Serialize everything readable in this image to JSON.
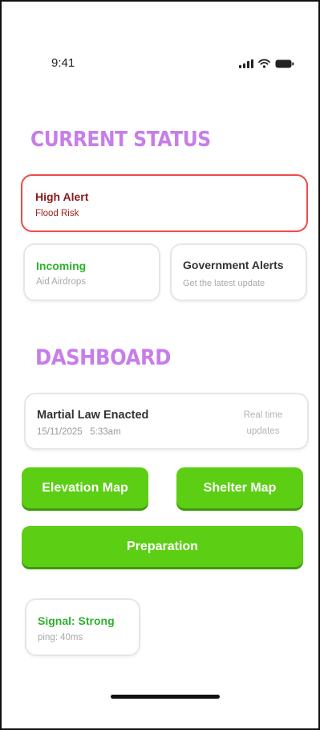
{
  "status_bar": {
    "time": "9:41",
    "icons": [
      "signal-icon",
      "wifi-icon",
      "battery-icon"
    ]
  },
  "current_status": {
    "title": "CURRENT STATUS",
    "alert": {
      "label": "High Alert",
      "sub": "Flood Risk"
    },
    "incoming": {
      "label": "Incoming",
      "sub": "Aid Airdrops"
    },
    "government": {
      "label": "Government Alerts",
      "sub": "Get the latest update"
    }
  },
  "dashboard": {
    "title": "DASHBOARD",
    "news": {
      "headline": "Martial Law Enacted",
      "timestamp": "15/11/2025   5:33am",
      "realtime_label": "Real time updates"
    },
    "buttons": {
      "elevation_map": "Elevation Map",
      "shelter_map": "Shelter Map",
      "preparation": "Preparation"
    },
    "signal": {
      "label": "Signal: Strong",
      "ping": "ping: 40ms"
    }
  },
  "colors": {
    "title": "#c77dea",
    "accent_green": "#5ccf14",
    "alert_border": "#ef4b4b",
    "alert_text": "#8b1a1a",
    "positive_text": "#2fb02f"
  }
}
